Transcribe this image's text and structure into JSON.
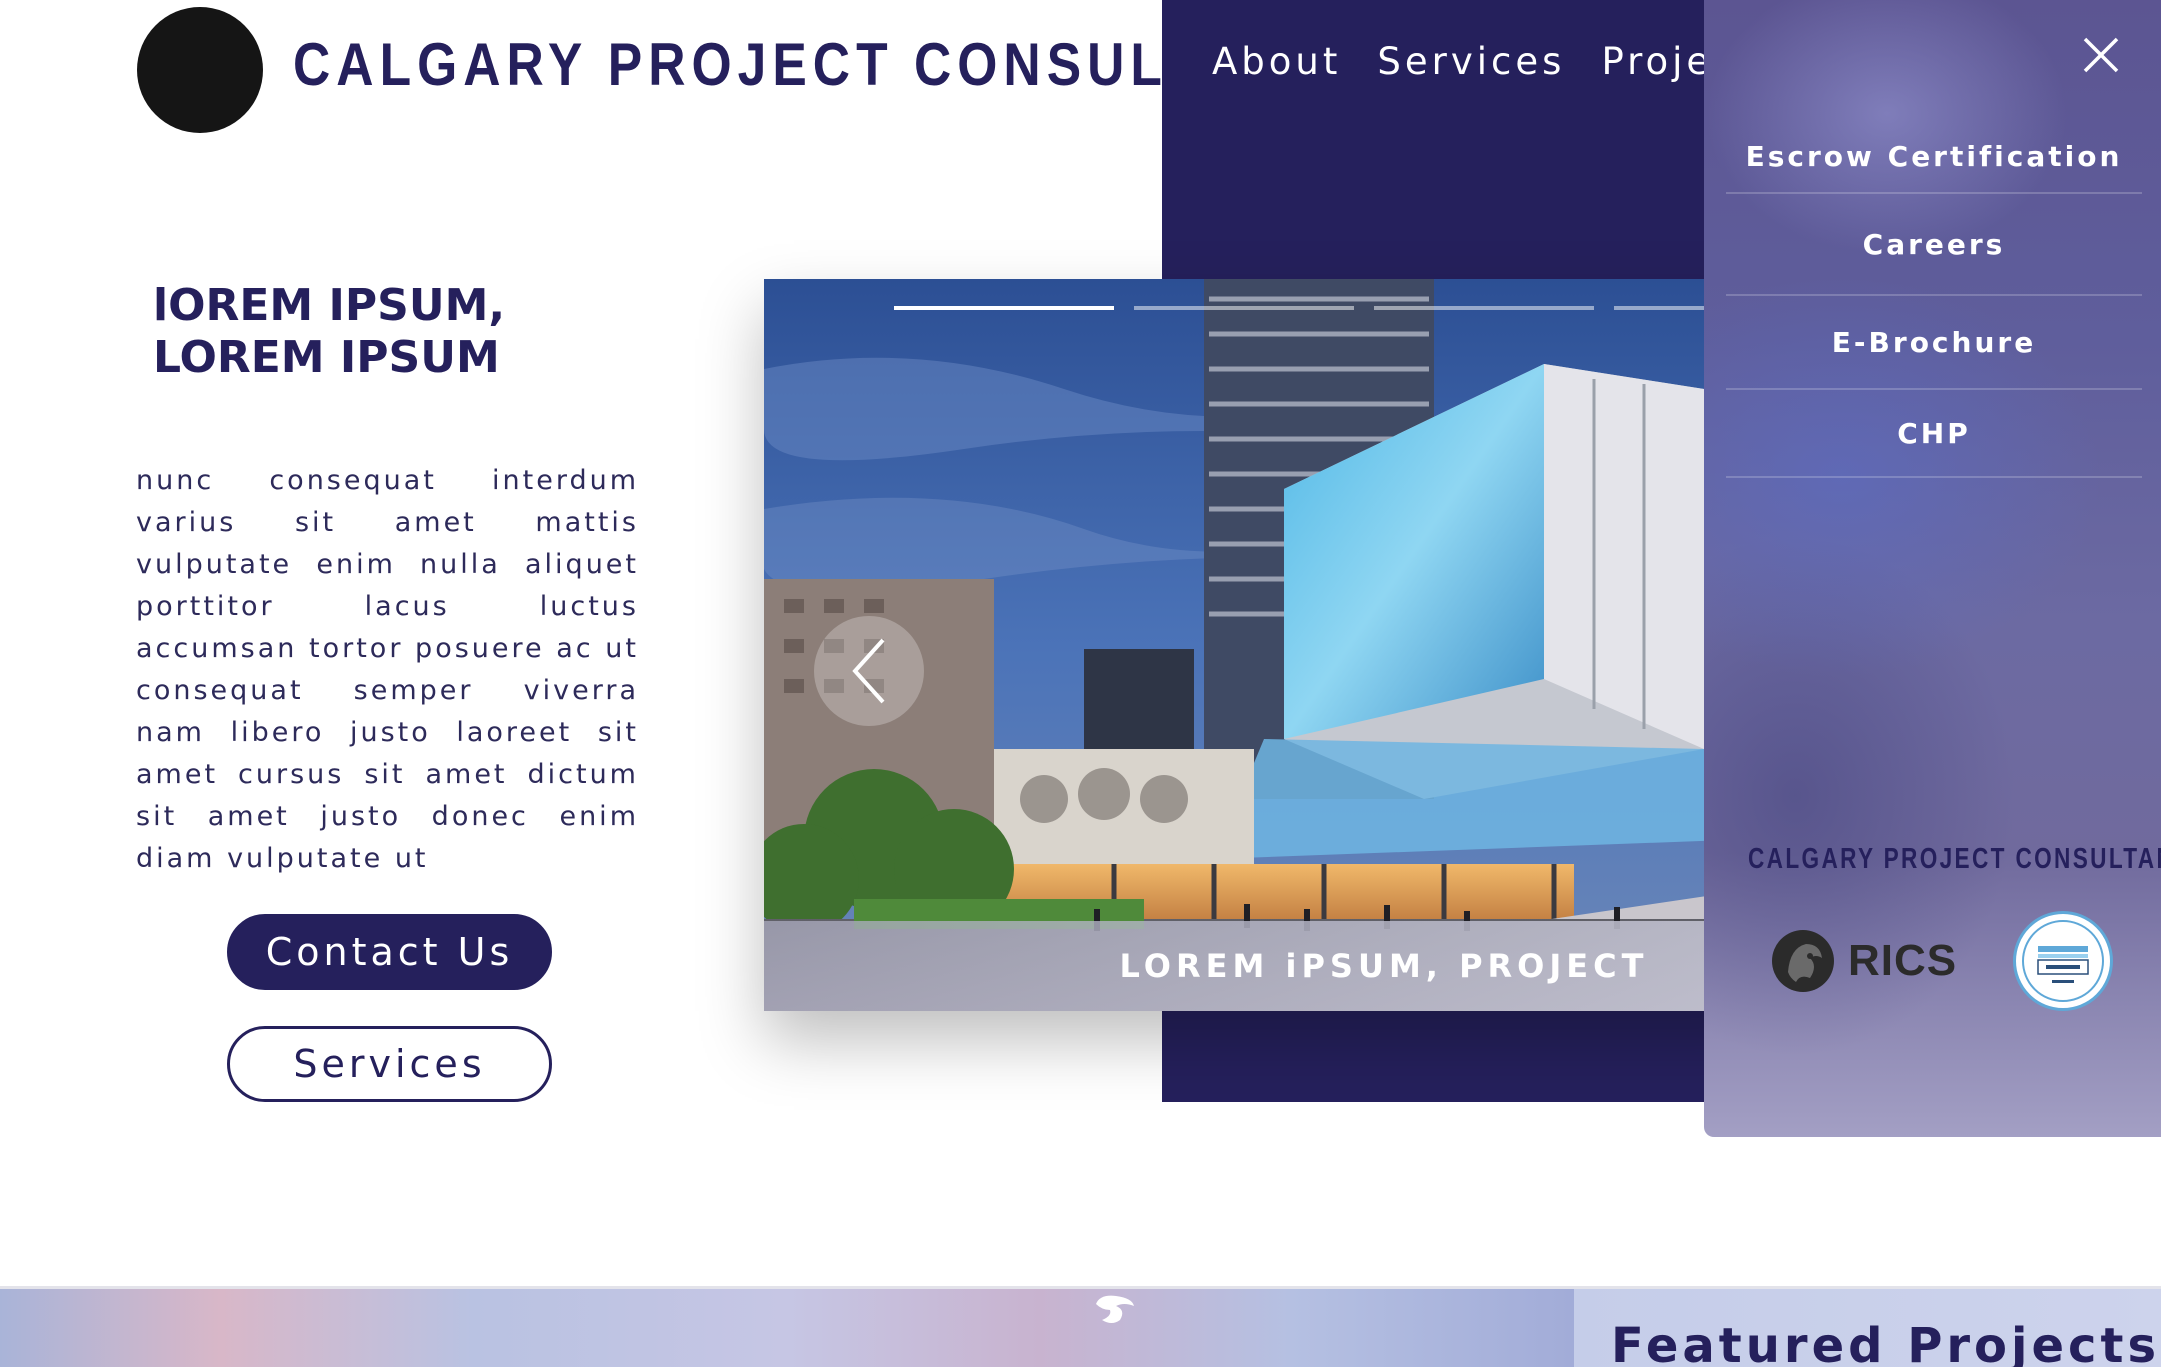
{
  "header": {
    "brand_name": "CALGARY PROJECT CONSULTANTS"
  },
  "nav": {
    "items": [
      "About",
      "Services",
      "Projects"
    ]
  },
  "hero": {
    "title": "lOREM IPSUM, LOREM IPSUM",
    "body": "nunc consequat interdum varius sit amet mattis vulputate enim nulla aliquet porttitor lacus luctus accumsan tortor posuere ac ut consequat semper viverra nam libero justo laoreet sit amet cursus sit amet dictum sit amet justo donec enim diam vulputate ut",
    "contact_label": "Contact Us",
    "services_label": "Services"
  },
  "slider": {
    "caption": "LOREM iPSUM, PROJECT",
    "slide_count": 4,
    "active_slide": 1
  },
  "menu": {
    "items": [
      "Escrow Certification",
      "Careers",
      "E-Brochure",
      "CHP"
    ],
    "brand": "CALGARY PROJECT CONSULTANTS",
    "rics_label": "RICS"
  },
  "featured": {
    "title": "Featured Projects"
  },
  "colors": {
    "brand_navy": "#25205c",
    "panel_violet": "#6c6aa2",
    "white": "#ffffff"
  },
  "icons": [
    "close-icon",
    "chevron-left-icon",
    "rics-lion-icon",
    "dnv-gl-badge-icon",
    "scroll-logo-icon"
  ]
}
